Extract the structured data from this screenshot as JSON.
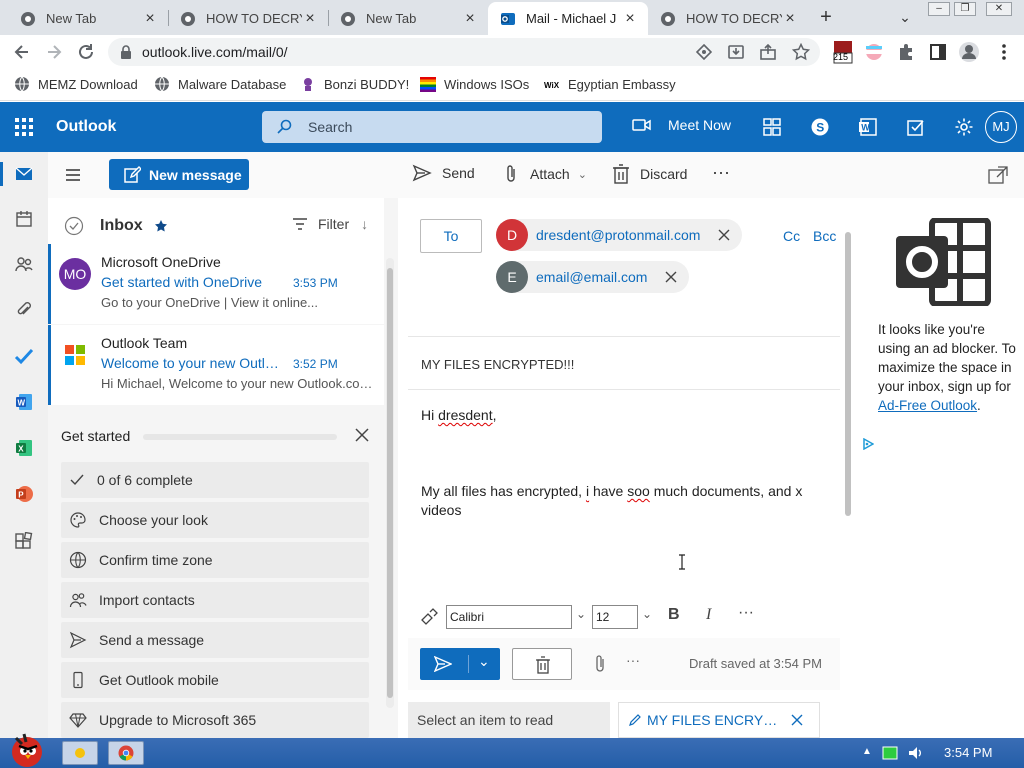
{
  "browser": {
    "tabs": [
      {
        "title": "New Tab",
        "active": false,
        "icon": "chrome-icon"
      },
      {
        "title": "HOW TO DECRYPT",
        "active": false,
        "icon": "chrome-icon"
      },
      {
        "title": "New Tab",
        "active": false,
        "icon": "chrome-icon"
      },
      {
        "title": "Mail - Michael J",
        "active": true,
        "icon": "outlook-icon"
      },
      {
        "title": "HOW TO DECRYPT",
        "active": false,
        "icon": "chrome-icon"
      }
    ],
    "url": "outlook.live.com/mail/0/",
    "extension_badge": "215",
    "bookmarks": [
      {
        "label": "MEMZ Download",
        "icon": "globe-icon"
      },
      {
        "label": "Malware Database",
        "icon": "globe-icon"
      },
      {
        "label": "Bonzi BUDDY!",
        "icon": "bonzi-icon"
      },
      {
        "label": "Windows ISOs",
        "icon": "windows-flag-icon"
      },
      {
        "label": "Egyptian Embassy",
        "icon": "wix-icon"
      }
    ]
  },
  "header": {
    "app_name": "Outlook",
    "search_placeholder": "Search",
    "meet_now": "Meet Now",
    "avatar_initials": "MJ"
  },
  "commands": {
    "new_message": "New message",
    "send": "Send",
    "attach": "Attach",
    "discard": "Discard"
  },
  "folder": {
    "name": "Inbox",
    "filter": "Filter",
    "messages": [
      {
        "from": "Microsoft OneDrive",
        "avatar": "MO",
        "avatar_color": "#6b2fa0",
        "subject": "Get started with OneDrive",
        "time": "3:53 PM",
        "preview": "Go to your OneDrive | View it online..."
      },
      {
        "from": "Outlook Team",
        "avatar": "",
        "avatar_color": "",
        "subject": "Welcome to your new Outlook.com account",
        "time": "3:52 PM",
        "preview": "Hi Michael, Welcome to your new Outlook.com account"
      }
    ]
  },
  "get_started": {
    "title": "Get started",
    "progress_fraction": 0.0,
    "items": [
      {
        "label": "0 of 6 complete",
        "icon": "checkmark-icon"
      },
      {
        "label": "Choose your look",
        "icon": "palette-icon"
      },
      {
        "label": "Confirm time zone",
        "icon": "globe-icon"
      },
      {
        "label": "Import contacts",
        "icon": "people-icon"
      },
      {
        "label": "Send a message",
        "icon": "send-icon"
      },
      {
        "label": "Get Outlook mobile",
        "icon": "phone-icon"
      },
      {
        "label": "Upgrade to Microsoft 365",
        "icon": "diamond-icon"
      }
    ]
  },
  "compose": {
    "to_label": "To",
    "recipients": [
      {
        "initial": "D",
        "address": "dresdent@protonmail.com",
        "color": "#d13438"
      },
      {
        "initial": "E",
        "address": "email@email.com",
        "color": "#5f6b6d"
      }
    ],
    "cc": "Cc",
    "bcc": "Bcc",
    "subject": "MY FILES ENCRYPTED!!!",
    "body_greeting_prefix": "Hi ",
    "body_greeting_name": "dresdent",
    "body_greeting_suffix": ",",
    "body_line_a": "My all files has encrypted, ",
    "body_line_b": "i",
    "body_line_c": " have ",
    "body_line_d": "soo",
    "body_line_e": " much documents, and x videos",
    "font_name": "Calibri",
    "font_size": "12",
    "draft_status": "Draft saved at 3:54 PM"
  },
  "ad": {
    "text_before": "It looks like you're using an ad blocker. To maximize the space in your inbox, sign up for ",
    "link": "Ad-Free Outlook",
    "text_after": "."
  },
  "bottom_tabs": {
    "reading": "Select an item to read",
    "draft": "MY FILES ENCRYPTED!!!"
  },
  "taskbar": {
    "clock": "3:54 PM"
  },
  "colors": {
    "accent": "#0f6cbd",
    "header": "#0f6cbd",
    "taskbar": "#245ea8"
  }
}
